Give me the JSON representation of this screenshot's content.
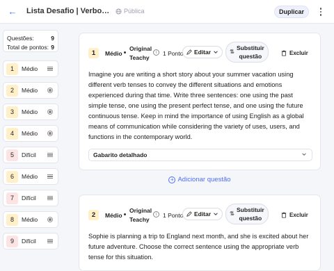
{
  "header": {
    "title": "Lista Desafio | Verbos: Exe...",
    "visibility": "Pública",
    "duplicate_label": "Duplicar"
  },
  "summary": {
    "questions_label": "Questões:",
    "questions_count": "9",
    "points_label": "Total de pontos:",
    "points_count": "9"
  },
  "sidebar": {
    "items": [
      {
        "num": "1",
        "level": "Médio",
        "icon": "lines-icon"
      },
      {
        "num": "2",
        "level": "Médio",
        "icon": "radio-icon"
      },
      {
        "num": "3",
        "level": "Médio",
        "icon": "radio-icon"
      },
      {
        "num": "4",
        "level": "Médio",
        "icon": "radio-icon"
      },
      {
        "num": "5",
        "level": "Difícil",
        "icon": "lines-icon"
      },
      {
        "num": "6",
        "level": "Médio",
        "icon": "lines-icon"
      },
      {
        "num": "7",
        "level": "Difícil",
        "icon": "lines-icon"
      },
      {
        "num": "8",
        "level": "Médio",
        "icon": "radio-icon"
      },
      {
        "num": "9",
        "level": "Difícil",
        "icon": "lines-icon"
      }
    ]
  },
  "questions": [
    {
      "num": "1",
      "level": "Médio",
      "origin": "Original Teachy",
      "points": "1 Ponto",
      "edit_label": "Editar",
      "substitute_label": "Substituir questão",
      "delete_label": "Excluir",
      "text": "Imagine you are writing a short story about your summer vacation using different verb tenses to convey the different situations and emotions experienced during that time. Write three sentences: one using the past simple tense, one using the present perfect tense, and one using the future continuous tense. Keep in mind the importance of using English as a global means of communication while considering the variety of uses, users, and functions in the contemporary world.",
      "answer_key_label": "Gabarito detalhado"
    },
    {
      "num": "2",
      "level": "Médio",
      "origin": "Original Teachy",
      "points": "1 Ponto",
      "edit_label": "Editar",
      "substitute_label": "Substituir questão",
      "delete_label": "Excluir",
      "text": "Sophie is planning a trip to England next month, and she is excited about her future adventure. Choose the correct sentence using the appropriate verb tense for this situation."
    }
  ],
  "add_question_label": "Adicionar questão",
  "colors": {
    "accent": "#4c6ef5",
    "medio_badge": "#fff0c9",
    "dificil_badge": "#fde4e4"
  }
}
